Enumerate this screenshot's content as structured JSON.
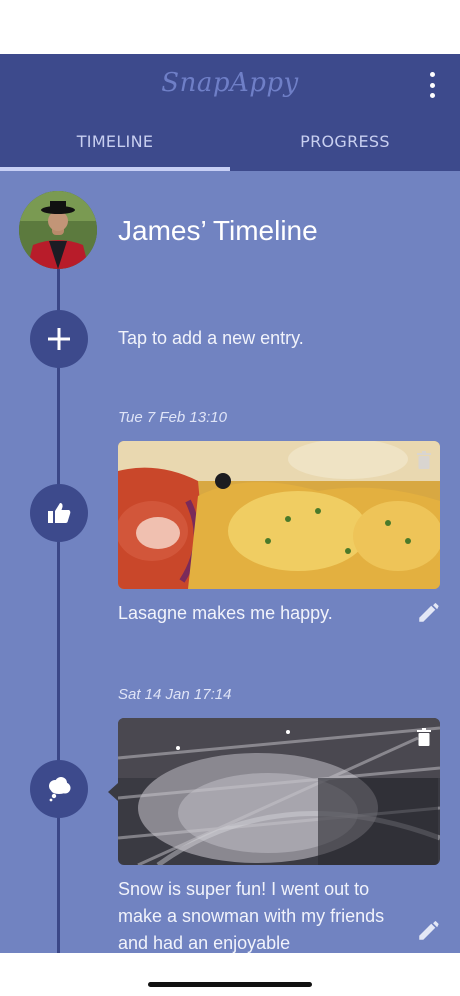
{
  "app": {
    "title": "SnapAppy",
    "menu_icon": "more-vert-icon"
  },
  "tabs": [
    {
      "label": "TIMELINE",
      "active": true
    },
    {
      "label": "PROGRESS",
      "active": false
    }
  ],
  "timeline": {
    "title": "James’ Timeline",
    "add_prompt": "Tap to add a new entry.",
    "entries": [
      {
        "date": "Tue 7 Feb 13:10",
        "mood_icon": "thumbs-up-icon",
        "caption": "Lasagne makes me happy."
      },
      {
        "date": "Sat 14 Jan 17:14",
        "mood_icon": "thought-bubble-icon",
        "caption": "Snow is super fun! I went out to make a snowman with my friends and had an enjoyable"
      }
    ]
  },
  "colors": {
    "appbar": "#3d4a8c",
    "background": "#7183c1",
    "node": "#3d4a8c",
    "tab_indicator": "#c7cff5"
  }
}
